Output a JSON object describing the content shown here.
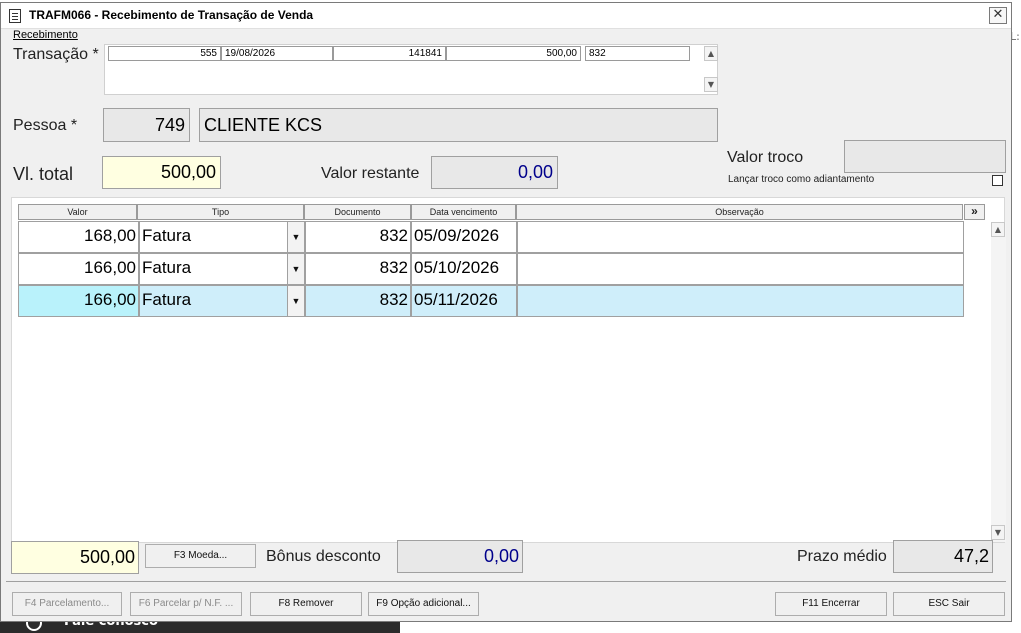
{
  "background": {
    "strip_text": "Fale conosco",
    "right_edge_char": "L:"
  },
  "window": {
    "title": "TRAFM066 - Recebimento de Transação de Venda",
    "close_glyph": "✕"
  },
  "group_label": "Recebimento",
  "transacao": {
    "label": "Transação *",
    "cells": [
      "555",
      "19/08/2026",
      "141841",
      "500,00",
      "832"
    ],
    "scroll_up": "▲",
    "scroll_down": "▼"
  },
  "pessoa": {
    "label": "Pessoa *",
    "code": "749",
    "name": "CLIENTE  KCS"
  },
  "valor_total": {
    "label": "Vl. total",
    "value": "500,00"
  },
  "valor_restante": {
    "label": "Valor restante",
    "value": "0,00"
  },
  "valor_troco": {
    "label": "Valor troco",
    "value": ""
  },
  "lancar_troco": {
    "label": "Lançar troco como adiantamento",
    "checked": false
  },
  "grid": {
    "headers": [
      "Valor",
      "Tipo",
      "Documento",
      "Data vencimento",
      "Observação"
    ],
    "expand_label": "»",
    "rows": [
      {
        "valor": "168,00",
        "tipo": "Fatura",
        "documento": "832",
        "vencimento": "05/09/2026",
        "observacao": ""
      },
      {
        "valor": "166,00",
        "tipo": "Fatura",
        "documento": "832",
        "vencimento": "05/10/2026",
        "observacao": ""
      },
      {
        "valor": "166,00",
        "tipo": "Fatura",
        "documento": "832",
        "vencimento": "05/11/2026",
        "observacao": ""
      }
    ],
    "selected_row": 2,
    "combo_arrow": "▼",
    "scroll_up": "▲",
    "scroll_down": "▼"
  },
  "footer": {
    "total": "500,00",
    "moeda_button": "F3 Moeda...",
    "bonus_label": "Bônus desconto",
    "bonus_value": "0,00",
    "prazo_label": "Prazo médio",
    "prazo_value": "47,2"
  },
  "buttons": {
    "parcelamento": "F4 Parcelamento...",
    "parcelar_nf": "F6 Parcelar p/ N.F. ...",
    "remover": "F8 Remover",
    "opcao_adicional": "F9 Opção adicional...",
    "encerrar": "F11 Encerrar",
    "sair": "ESC Sair"
  },
  "colors": {
    "value_blue": "#00008b",
    "highlight_yellow": "#ffffe1",
    "selected_row": "#cfeefa"
  }
}
